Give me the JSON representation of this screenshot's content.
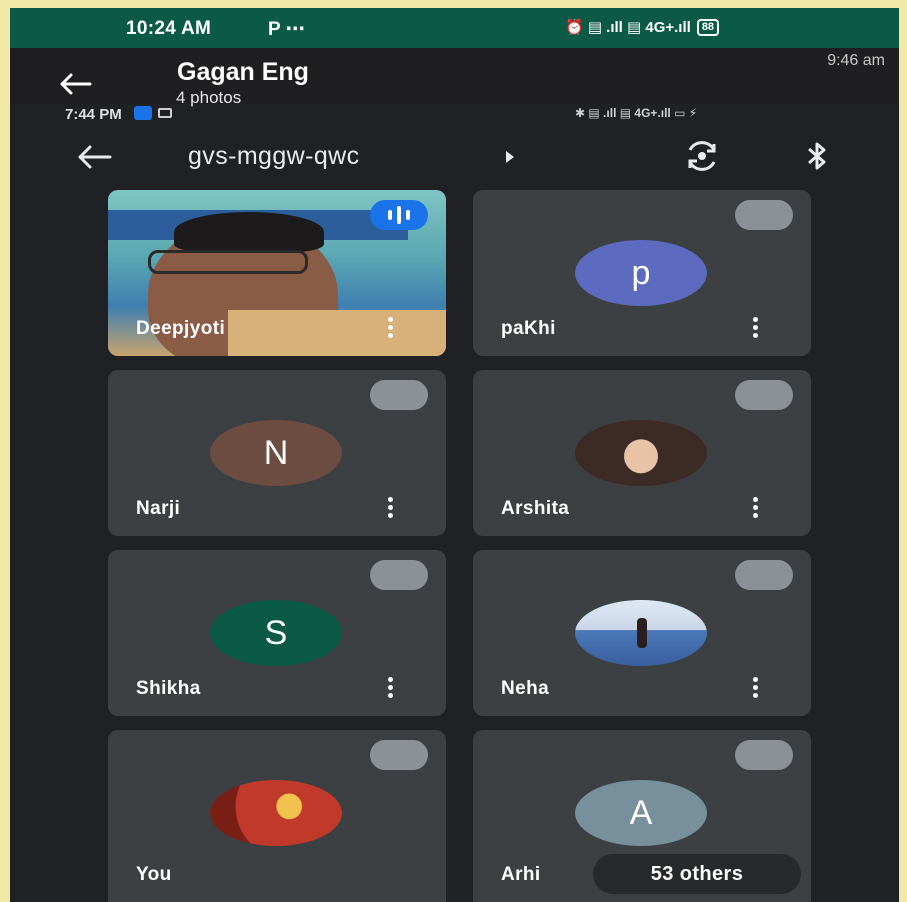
{
  "outer_status": {
    "time": "10:24 AM",
    "extra": "P ⋯",
    "right": "⏰ ▤ .ıll ▤ 4G+.ıll",
    "battery": "88"
  },
  "chat_header": {
    "title": "Gagan Eng",
    "subtitle": "4 photos",
    "time": "9:46 am"
  },
  "inner_status": {
    "time": "7:44 PM",
    "right": "✱ ▤ .ıll ▤ 4G+.ıll ▭ ⚡"
  },
  "meet": {
    "code": "gvs-mggw-qwc"
  },
  "participants": [
    {
      "name": "Deepjyoti",
      "avatar": "",
      "color": "#6c8b97"
    },
    {
      "name": "paKhi",
      "avatar": "p",
      "color": "#5c6bc0"
    },
    {
      "name": "Narji",
      "avatar": "N",
      "color": "#6d4c41"
    },
    {
      "name": "Arshita",
      "avatar": "",
      "color": "#5a4a46"
    },
    {
      "name": "Shikha",
      "avatar": "S",
      "color": "#0b5a45"
    },
    {
      "name": "Neha",
      "avatar": "",
      "color": "#4b79b8"
    },
    {
      "name": "You",
      "avatar": "",
      "color": "#b23a2a"
    },
    {
      "name": "Arhi",
      "avatar": "A",
      "color": "#78909c"
    }
  ],
  "others_label": "53 others"
}
